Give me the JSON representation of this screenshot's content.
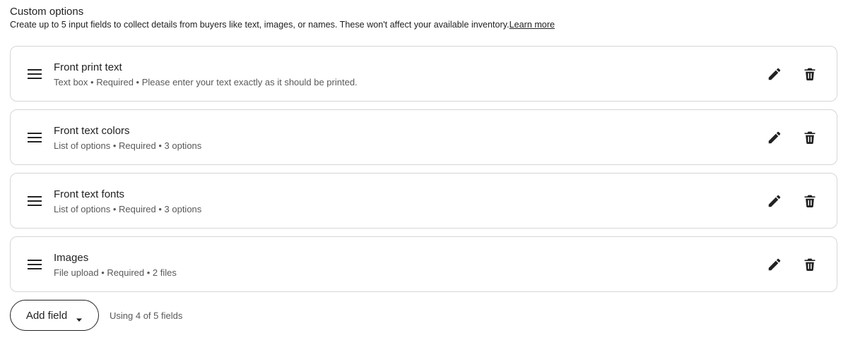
{
  "section": {
    "title": "Custom options",
    "description": "Create up to 5 input fields to collect details from buyers like text, images, or names. These won't affect your available inventory.",
    "learn_more": "Learn more"
  },
  "fields": [
    {
      "name": "Front print text",
      "meta": "Text box • Required • Please enter your text exactly as it should be printed."
    },
    {
      "name": "Front text colors",
      "meta": "List of options • Required • 3 options"
    },
    {
      "name": "Front text fonts",
      "meta": "List of options • Required • 3 options"
    },
    {
      "name": "Images",
      "meta": "File upload • Required • 2 files"
    }
  ],
  "footer": {
    "add_field_label": "Add field",
    "usage_text": "Using 4 of 5 fields"
  },
  "icons": {
    "drag": "drag-handle-icon",
    "edit": "pencil-icon",
    "delete": "trash-icon",
    "caret": "caret-down-icon"
  }
}
